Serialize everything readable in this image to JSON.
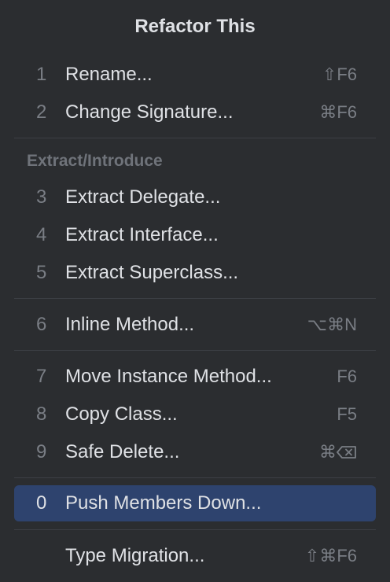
{
  "popup": {
    "title": "Refactor This",
    "group_header": "Extract/Introduce",
    "items": [
      {
        "number": "1",
        "label": "Rename...",
        "shortcut": "⇧F6"
      },
      {
        "number": "2",
        "label": "Change Signature...",
        "shortcut": "⌘F6"
      },
      {
        "number": "3",
        "label": "Extract Delegate...",
        "shortcut": ""
      },
      {
        "number": "4",
        "label": "Extract Interface...",
        "shortcut": ""
      },
      {
        "number": "5",
        "label": "Extract Superclass...",
        "shortcut": ""
      },
      {
        "number": "6",
        "label": "Inline Method...",
        "shortcut": "⌥⌘N"
      },
      {
        "number": "7",
        "label": "Move Instance Method...",
        "shortcut": "F6"
      },
      {
        "number": "8",
        "label": "Copy Class...",
        "shortcut": "F5"
      },
      {
        "number": "9",
        "label": "Safe Delete...",
        "shortcut": "⌘",
        "shortcut_icon": "delete-key-icon"
      },
      {
        "number": "0",
        "label": "Push Members Down...",
        "shortcut": "",
        "selected": true
      },
      {
        "number": "",
        "label": "Type Migration...",
        "shortcut": "⇧⌘F6"
      }
    ]
  },
  "colors": {
    "background": "#2b2d30",
    "text": "#dfe1e5",
    "muted": "#7a7e85",
    "selection": "#2e436e",
    "divider": "#3c3f44"
  }
}
